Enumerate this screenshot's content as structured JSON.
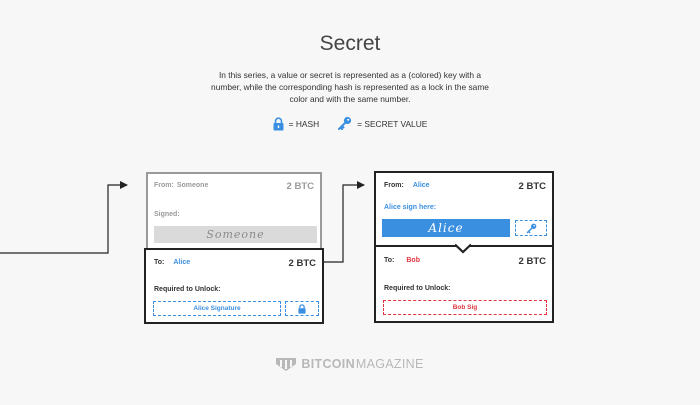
{
  "title": "Secret",
  "description": "In this series, a value or secret is represented as a (colored) key with a number, while the corresponding hash is represented as a lock in the same color and with the same number.",
  "legend": {
    "hash_label": "= HASH",
    "secret_label": "= SECRET VALUE",
    "hash_icon": "lock-icon",
    "secret_icon": "key-icon",
    "color": "#3b8fe0"
  },
  "left_tx": {
    "input": {
      "from_label": "From:",
      "from_name": "Someone",
      "amount": "2 BTC",
      "signed_label": "Signed:",
      "signature": "Someone"
    },
    "output": {
      "to_label": "To:",
      "to_name": "Alice",
      "amount": "2 BTC",
      "required_label": "Required to Unlock:",
      "signature_req": "Alice Signature"
    }
  },
  "right_tx": {
    "input": {
      "from_label": "From:",
      "from_name": "Alice",
      "amount": "2 BTC",
      "sign_here_label": "Alice sign here:",
      "signature": "Alice"
    },
    "output": {
      "to_label": "To:",
      "to_name": "Bob",
      "amount": "2 BTC",
      "required_label": "Required to Unlock:",
      "signature_req": "Bob Sig"
    }
  },
  "footer": {
    "brand_bold": "BITCOIN",
    "brand_light": "MAGAZINE"
  },
  "colors": {
    "blue": "#3b8fe0",
    "red": "#e0343f",
    "ghost_border": "#9a9a9a",
    "border": "#222222"
  }
}
